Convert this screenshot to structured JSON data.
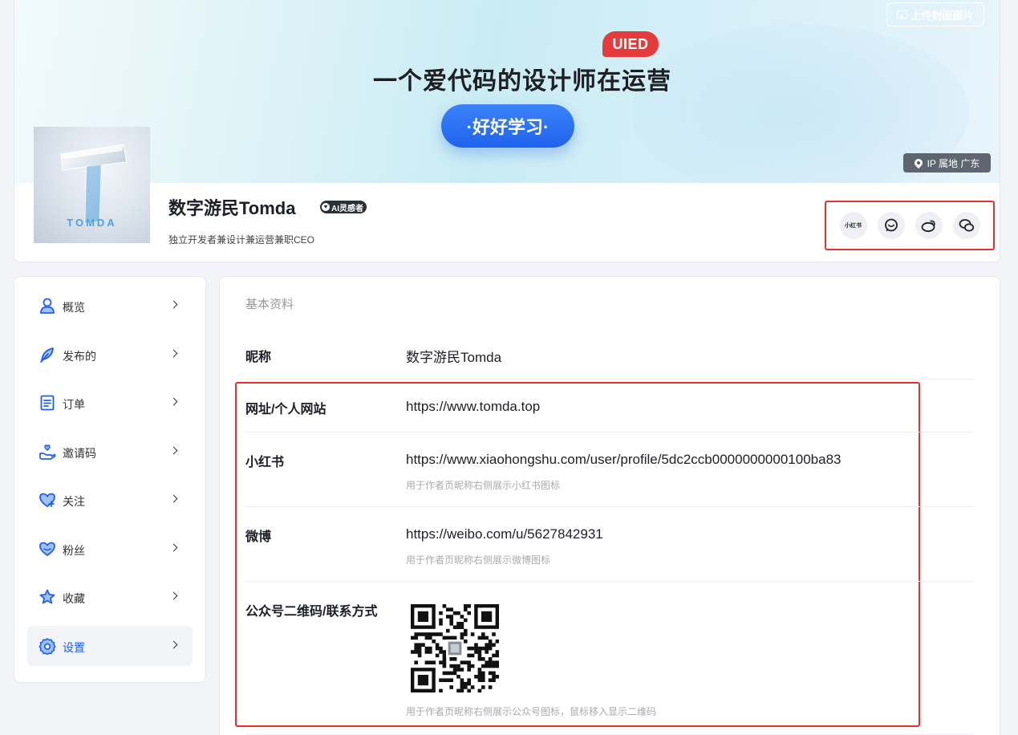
{
  "header": {
    "upload_cover_label": "上传封面图片",
    "banner_badge": "UIED",
    "banner_title": "一个爱代码的设计师在运营",
    "banner_pill": "·好好学习·",
    "ip_label": "IP 属地  广东",
    "avatar_text": "TOMDA",
    "user_name": "数字游民Tomda",
    "ai_badge": "AI灵感者",
    "bio": "独立开发者兼设计兼运营兼职CEO",
    "social": {
      "xiaohongshu_label": "小红书"
    }
  },
  "sidebar": {
    "items": [
      {
        "label": "概览",
        "icon": "user-icon"
      },
      {
        "label": "发布的",
        "icon": "feather-icon"
      },
      {
        "label": "订单",
        "icon": "order-icon"
      },
      {
        "label": "邀请码",
        "icon": "invite-icon"
      },
      {
        "label": "关注",
        "icon": "heart-plus-icon"
      },
      {
        "label": "粉丝",
        "icon": "heart-fans-icon"
      },
      {
        "label": "收藏",
        "icon": "star-icon"
      },
      {
        "label": "设置",
        "icon": "gear-icon",
        "active": true
      }
    ]
  },
  "profile": {
    "section_title": "基本资料",
    "fields": [
      {
        "label": "昵称",
        "value": "数字游民Tomda"
      },
      {
        "label": "网址/个人网站",
        "value": "https://www.tomda.top"
      },
      {
        "label": "小红书",
        "value": "https://www.xiaohongshu.com/user/profile/5dc2ccb0000000000100ba83",
        "hint": "用于作者页昵称右侧展示小红书图标"
      },
      {
        "label": "微博",
        "value": "https://weibo.com/u/5627842931",
        "hint": "用于作者页昵称右侧展示微博图标"
      },
      {
        "label": "公众号二维码/联系方式",
        "hint": "用于作者页昵称右侧展示公众号图标，鼠标移入显示二维码"
      }
    ]
  },
  "colors": {
    "accent": "#1e5ef0",
    "highlight_border": "#e0322b",
    "banner_pill": "#2a6ef5",
    "badge_red": "#e53b3b"
  }
}
